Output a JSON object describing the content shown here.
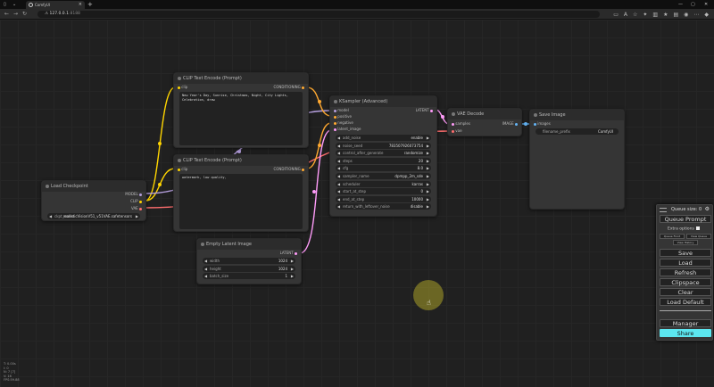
{
  "browser": {
    "tab_title": "ComfyUI",
    "url_host": "127.0.0.1",
    "url_path": ":8188"
  },
  "nodes": {
    "clip1": {
      "title": "CLIP Text Encode (Prompt)",
      "in_clip": "clip",
      "out": "CONDITIONING",
      "text": "New Year's Day, Sunrise, Christmas, Night, City Lights, Celebration, draw"
    },
    "clip2": {
      "title": "CLIP Text Encode (Prompt)",
      "in_clip": "clip",
      "out": "CONDITIONING",
      "text": "watermark, low quality,"
    },
    "checkpoint": {
      "title": "Load Checkpoint",
      "out_model": "MODEL",
      "out_clip": "CLIP",
      "out_vae": "VAE",
      "ckpt_label": "ckpt_name",
      "ckpt_value": "realisticVisionV51_v51VAE.safetensors"
    },
    "ksampler": {
      "title": "KSampler (Advanced)",
      "in_model": "model",
      "in_positive": "positive",
      "in_negative": "negative",
      "in_latent": "latent_image",
      "out": "LATENT",
      "widgets": [
        {
          "label": "add_noise",
          "value": "enable"
        },
        {
          "label": "noise_seed",
          "value": "783507926073754"
        },
        {
          "label": "control_after_generate",
          "value": "randomize"
        },
        {
          "label": "steps",
          "value": "20"
        },
        {
          "label": "cfg",
          "value": "8.0"
        },
        {
          "label": "sampler_name",
          "value": "dpmpp_2m_sde"
        },
        {
          "label": "scheduler",
          "value": "karras"
        },
        {
          "label": "start_at_step",
          "value": "0"
        },
        {
          "label": "end_at_step",
          "value": "10000"
        },
        {
          "label": "return_with_leftover_noise",
          "value": "disable"
        }
      ]
    },
    "vae": {
      "title": "VAE Decode",
      "in_samples": "samples",
      "in_vae": "vae",
      "out": "IMAGE"
    },
    "save": {
      "title": "Save Image",
      "in_images": "images",
      "prefix_label": "filename_prefix",
      "prefix_value": "ComfyUI"
    },
    "latent": {
      "title": "Empty Latent Image",
      "out": "LATENT",
      "widgets": [
        {
          "label": "width",
          "value": "1024"
        },
        {
          "label": "height",
          "value": "1024"
        },
        {
          "label": "batch_size",
          "value": "1"
        }
      ]
    }
  },
  "menu": {
    "queue_size": "Queue size: 0",
    "queue_prompt": "Queue Prompt",
    "extra_options": "Extra options",
    "queue_front": "Queue Front",
    "view_queue": "View Queue",
    "view_history": "View History",
    "save": "Save",
    "load": "Load",
    "refresh": "Refresh",
    "clipspace": "Clipspace",
    "clear": "Clear",
    "load_default": "Load Default",
    "manager": "Manager",
    "share": "Share"
  },
  "stats": [
    "T: 0.00s",
    "I: 0",
    "N: 7 [7]",
    "V: 16",
    "FPS:59.88"
  ],
  "colors": {
    "clip_link": "#ffd500",
    "model_link": "#b39ddb",
    "cond_link": "#ffa931",
    "latent_link": "#ff9cf9",
    "vae_link": "#ff6e6e",
    "image_link": "#64b5f6",
    "share_bg": "#5ce6ef"
  }
}
